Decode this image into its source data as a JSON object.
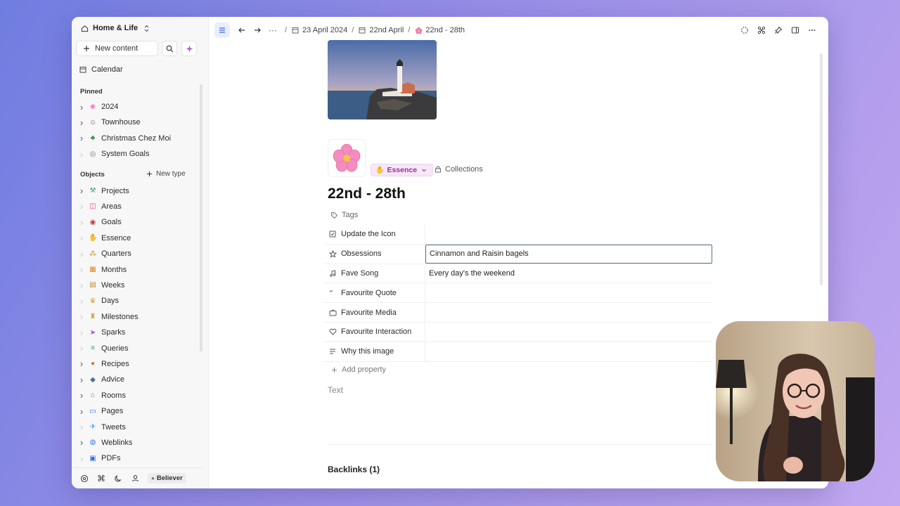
{
  "sidebar": {
    "space_name": "Home & Life",
    "new_content_label": "New content",
    "calendar_label": "Calendar",
    "pinned_label": "Pinned",
    "pinned": [
      {
        "label": "2024",
        "icon": "flower-emoji",
        "expand": true
      },
      {
        "label": "Townhouse",
        "icon": "person-emoji",
        "expand": true
      },
      {
        "label": "Christmas Chez Moi",
        "icon": "tree-emoji",
        "expand": true
      },
      {
        "label": "System Goals",
        "icon": "target-icon",
        "expand": false
      }
    ],
    "objects_label": "Objects",
    "new_type_label": "New type",
    "objects": [
      {
        "label": "Projects",
        "icon": "hammer-emoji",
        "expand": true
      },
      {
        "label": "Areas",
        "icon": "jar-emoji",
        "expand": false
      },
      {
        "label": "Goals",
        "icon": "target-emoji",
        "expand": false
      },
      {
        "label": "Essence",
        "icon": "hand-emoji",
        "expand": false
      },
      {
        "label": "Quarters",
        "icon": "cluster-icon",
        "expand": false
      },
      {
        "label": "Months",
        "icon": "calendar-icon",
        "expand": false
      },
      {
        "label": "Weeks",
        "icon": "calendar-week-icon",
        "expand": false
      },
      {
        "label": "Days",
        "icon": "crown-icon",
        "expand": false
      },
      {
        "label": "Milestones",
        "icon": "trophy-emoji",
        "expand": false
      },
      {
        "label": "Sparks",
        "icon": "send-icon",
        "expand": false
      },
      {
        "label": "Queries",
        "icon": "list-filter-icon",
        "expand": false
      },
      {
        "label": "Recipes",
        "icon": "food-emoji",
        "expand": true
      },
      {
        "label": "Advice",
        "icon": "speech-emoji",
        "expand": true
      },
      {
        "label": "Rooms",
        "icon": "house-emoji",
        "expand": true
      },
      {
        "label": "Pages",
        "icon": "page-icon",
        "expand": true
      },
      {
        "label": "Tweets",
        "icon": "bird-icon",
        "expand": false
      },
      {
        "label": "Weblinks",
        "icon": "globe-icon",
        "expand": true
      },
      {
        "label": "PDFs",
        "icon": "pdf-icon",
        "expand": false
      }
    ],
    "footer_badge": "Believer"
  },
  "breadcrumb": {
    "ellipsis": "···",
    "sep": "/",
    "items": [
      "23 April 2024",
      "22nd April",
      "22nd - 28th"
    ]
  },
  "page": {
    "type_label": "Essence",
    "collections_label": "Collections",
    "title": "22nd - 28th",
    "tags_label": "Tags",
    "properties": [
      {
        "name": "Update the Icon",
        "icon": "checkbox-icon",
        "value": ""
      },
      {
        "name": "Obsessions",
        "icon": "star-icon",
        "value": "Cinnamon and Raisin bagels",
        "editing": true
      },
      {
        "name": "Fave Song",
        "icon": "music-note-icon",
        "value": "Every day's the weekend"
      },
      {
        "name": "Favourite Quote",
        "icon": "quote-icon",
        "value": ""
      },
      {
        "name": "Favourite Media",
        "icon": "media-icon",
        "value": ""
      },
      {
        "name": "Favourite Interaction",
        "icon": "heart-icon",
        "value": ""
      },
      {
        "name": "Why this image",
        "icon": "text-lines-icon",
        "value": ""
      }
    ],
    "add_property_label": "Add property",
    "text_placeholder": "Text",
    "backlinks_label": "Backlinks (1)"
  },
  "colors": {
    "accent": "#3a6be0",
    "essence_pill": "#9a2ea0",
    "background_gradient_start": "#6f7de0",
    "background_gradient_end": "#c2a8f0"
  }
}
